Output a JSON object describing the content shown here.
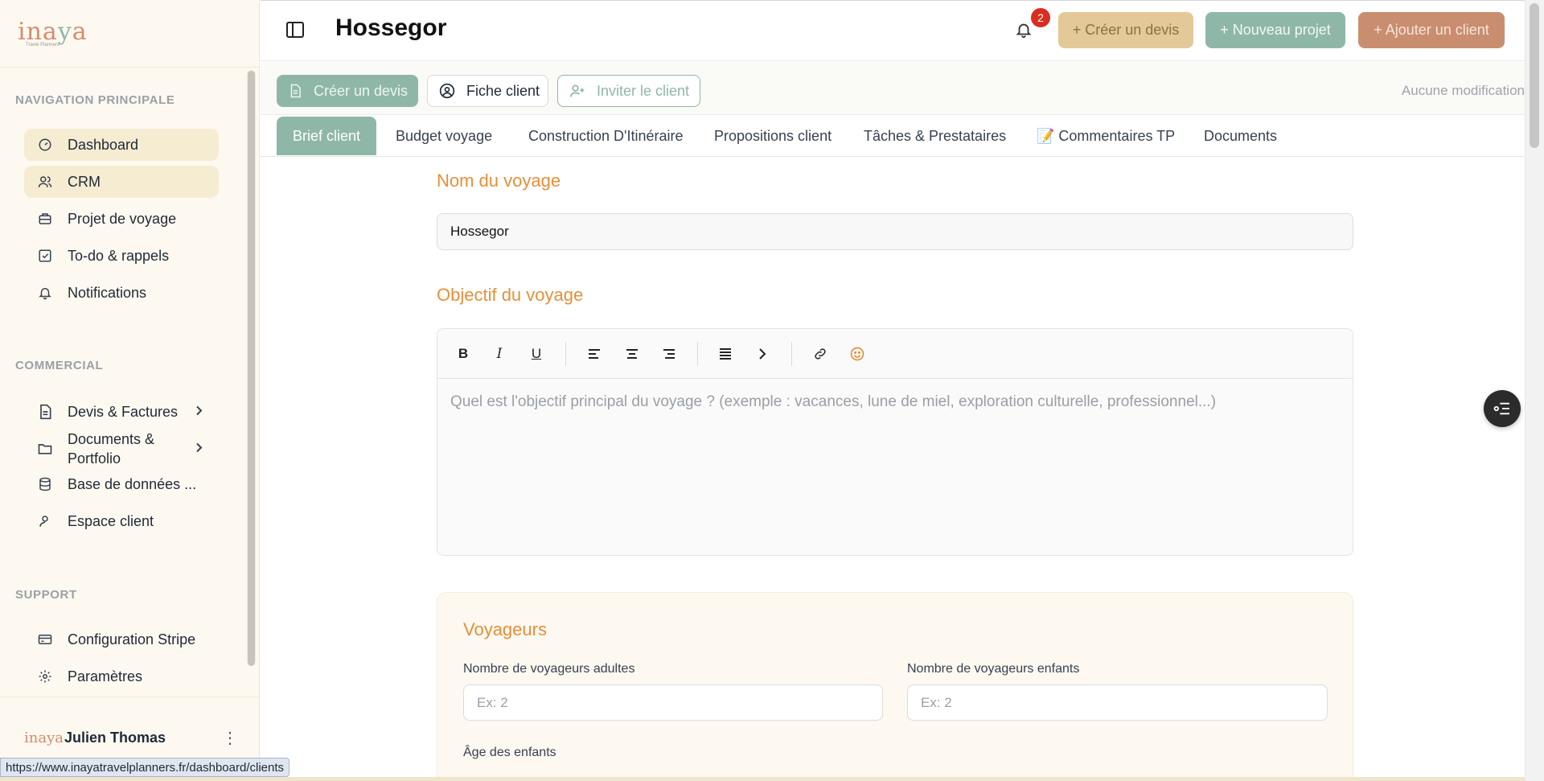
{
  "app": {
    "logo": "inaya",
    "logo_sub": "Travel Planners"
  },
  "sidebar": {
    "sections": [
      {
        "label": "NAVIGATION PRINCIPALE"
      },
      {
        "label": "COMMERCIAL"
      },
      {
        "label": "SUPPORT"
      }
    ],
    "items": [
      {
        "label": "Dashboard",
        "icon": "gauge-icon"
      },
      {
        "label": "CRM",
        "icon": "users-icon"
      },
      {
        "label": "Projet de voyage",
        "icon": "briefcase-icon"
      },
      {
        "label": "To-do & rappels",
        "icon": "checkbox-icon"
      },
      {
        "label": "Notifications",
        "icon": "bell-icon"
      },
      {
        "label": "Devis & Factures",
        "icon": "file-text-icon"
      },
      {
        "label": "Documents & Portfolio",
        "icon": "folder-icon"
      },
      {
        "label": "Base de données ...",
        "icon": "database-icon"
      },
      {
        "label": "Espace client",
        "icon": "user-icon"
      },
      {
        "label": "Configuration Stripe",
        "icon": "credit-card-icon"
      },
      {
        "label": "Paramètres",
        "icon": "settings-icon"
      }
    ],
    "user": {
      "name": "Julien Thomas",
      "logo": "inaya"
    }
  },
  "header": {
    "title": "Hossegor",
    "notification_count": "2",
    "buttons": {
      "devis": "+ Créer un devis",
      "projet": "+ Nouveau projet",
      "client": "+ Ajouter un client"
    }
  },
  "actionbar": {
    "creer": "Créer un devis",
    "fiche": "Fiche client",
    "inviter": "Inviter le client",
    "status": "Aucune modification"
  },
  "tabs": [
    {
      "label": "Brief client"
    },
    {
      "label": "Budget voyage"
    },
    {
      "label": "Construction D'Itinéraire"
    },
    {
      "label": "Propositions client"
    },
    {
      "label": "Tâches & Prestataires"
    },
    {
      "label": "📝 Commentaires TP"
    },
    {
      "label": "Documents"
    }
  ],
  "form": {
    "nom_title": "Nom du voyage",
    "nom_value": "Hossegor",
    "objectif_title": "Objectif du voyage",
    "objectif_placeholder": "Quel est l'objectif principal du voyage ? (exemple : vacances, lune de miel, exploration culturelle, professionnel...)",
    "voyageurs": {
      "title": "Voyageurs",
      "adultes_label": "Nombre de voyageurs adultes",
      "adultes_placeholder": "Ex: 2",
      "enfants_label": "Nombre de voyageurs enfants",
      "enfants_placeholder": "Ex: 2",
      "age_label": "Âge des enfants"
    }
  },
  "status_url": "https://www.inayatravelplanners.fr/dashboard/clients",
  "colors": {
    "sage": "#8fb7a7",
    "sand": "#e3c997",
    "terracotta": "#c98e70",
    "orange": "#e58f3a"
  }
}
